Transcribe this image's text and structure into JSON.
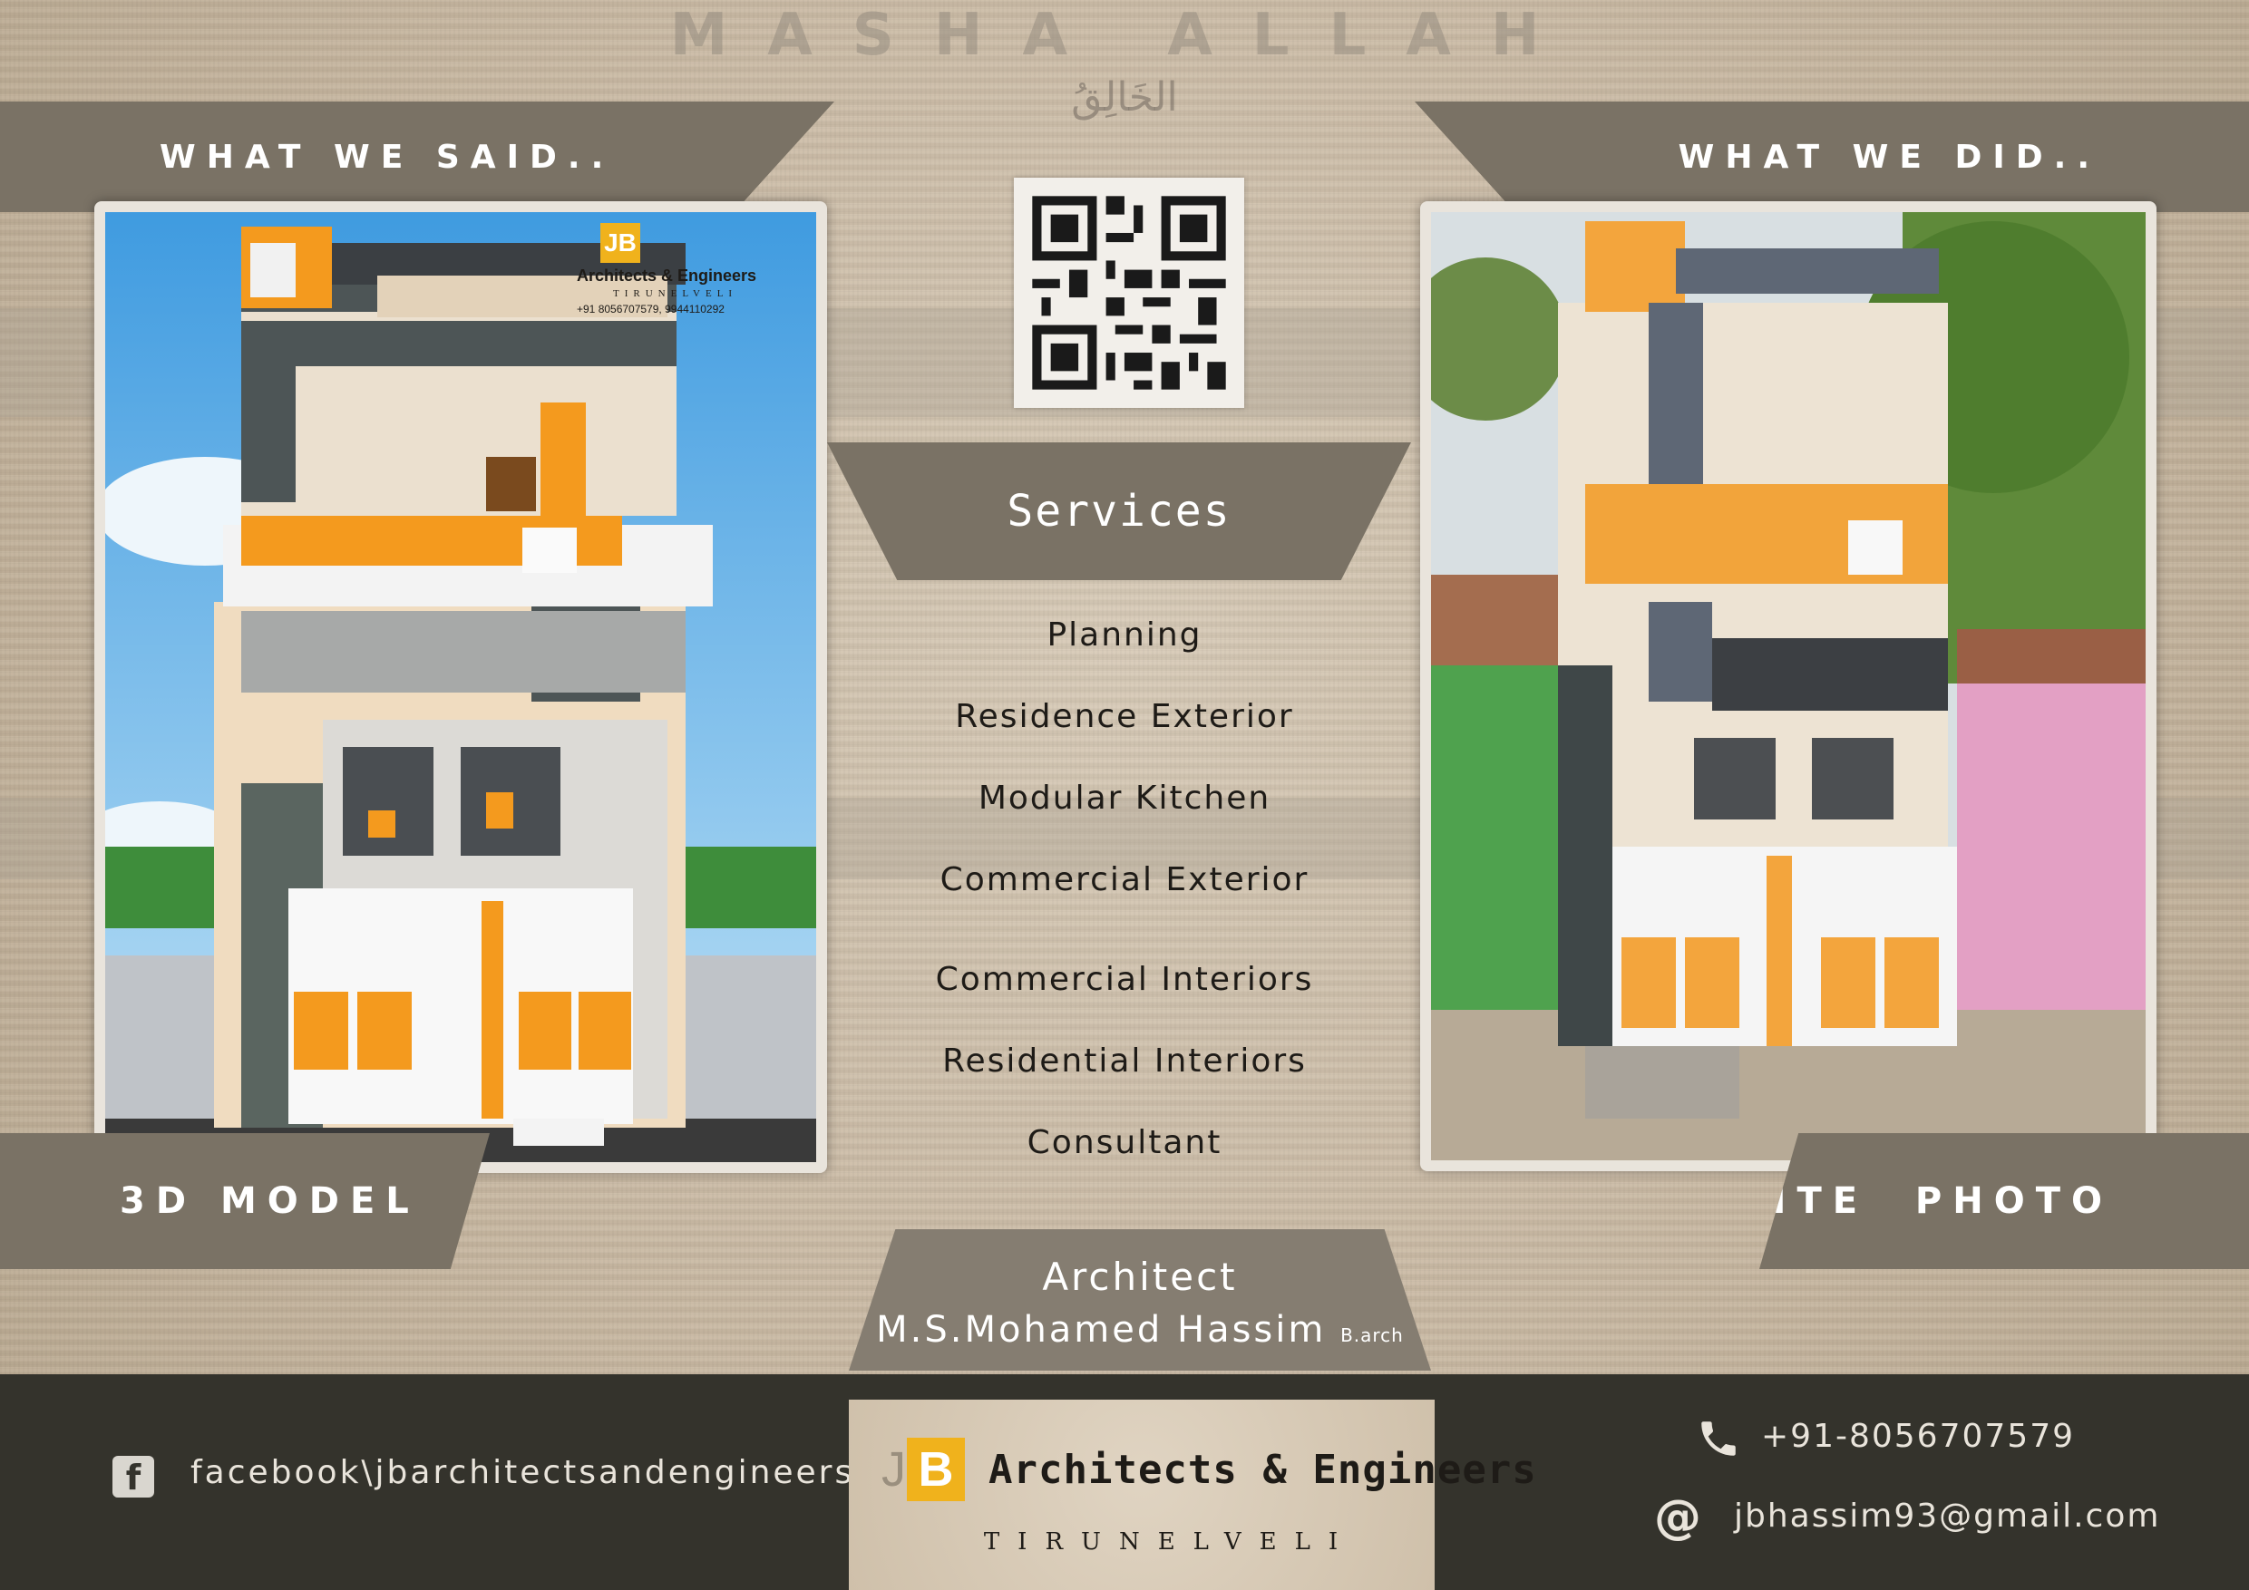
{
  "watermark": "MASHA ALLAH",
  "arabic_text": "الخَالِقُ",
  "ribbons": {
    "left_top": "WHAT WE SAID..",
    "right_top": "WHAT WE DID..",
    "left_bottom": "3D MODEL",
    "right_bottom": "SITE  PHOTO"
  },
  "render_overlay": {
    "logo_letters": "JB",
    "company": "Architects & Engineers",
    "city": "TIRUNELVELI",
    "phones": "+91 8056707579, 9944110292"
  },
  "services": {
    "title": "Services",
    "items": [
      "Planning",
      "Residence Exterior",
      "Modular Kitchen",
      "Commercial Exterior",
      "Commercial Interiors",
      "Residential Interiors",
      "Consultant"
    ]
  },
  "architect": {
    "title": "Architect",
    "name": "M.S.Mohamed Hassim",
    "degree": "B.arch"
  },
  "footer": {
    "facebook": "facebook\\jbarchitectsandengineers",
    "phone": "+91-8056707579",
    "email": "jbhassim93@gmail.com"
  },
  "brand": {
    "logo_j": "J",
    "logo_b": "B",
    "name": "Architects & Engineers",
    "city": "TIRUNELVELI"
  },
  "colors": {
    "accent_orange": "#f49a1e",
    "ribbon": "#7a7265",
    "footer": "#34332c",
    "logo_gold": "#f0b21c"
  },
  "icons": [
    "qr-code-icon",
    "facebook-icon",
    "phone-icon",
    "at-icon"
  ]
}
